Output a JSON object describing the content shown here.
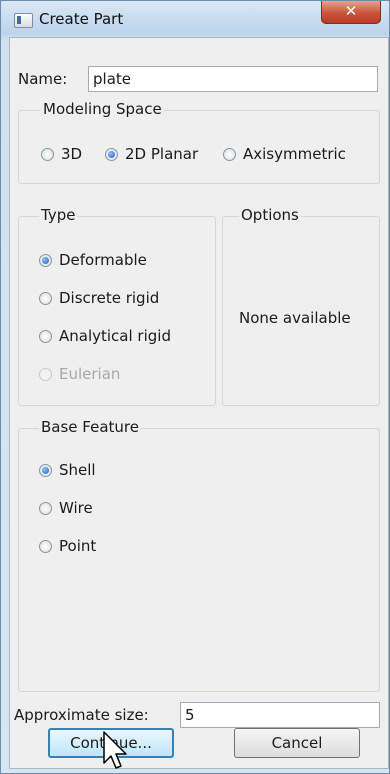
{
  "window": {
    "title": "Create Part",
    "close_glyph": "✕"
  },
  "name": {
    "label": "Name:",
    "value": "plate"
  },
  "modeling_space": {
    "title": "Modeling Space",
    "options": [
      {
        "label": "3D",
        "selected": false
      },
      {
        "label": "2D Planar",
        "selected": true
      },
      {
        "label": "Axisymmetric",
        "selected": false
      }
    ]
  },
  "type": {
    "title": "Type",
    "options": [
      {
        "label": "Deformable",
        "selected": true,
        "enabled": true
      },
      {
        "label": "Discrete rigid",
        "selected": false,
        "enabled": true
      },
      {
        "label": "Analytical rigid",
        "selected": false,
        "enabled": true
      },
      {
        "label": "Eulerian",
        "selected": false,
        "enabled": false
      }
    ]
  },
  "options_panel": {
    "title": "Options",
    "message": "None available"
  },
  "base_feature": {
    "title": "Base Feature",
    "options": [
      {
        "label": "Shell",
        "selected": true
      },
      {
        "label": "Wire",
        "selected": false
      },
      {
        "label": "Point",
        "selected": false
      }
    ]
  },
  "approx_size": {
    "label": "Approximate size:",
    "value": "5"
  },
  "buttons": {
    "continue": "Continue...",
    "cancel": "Cancel"
  }
}
